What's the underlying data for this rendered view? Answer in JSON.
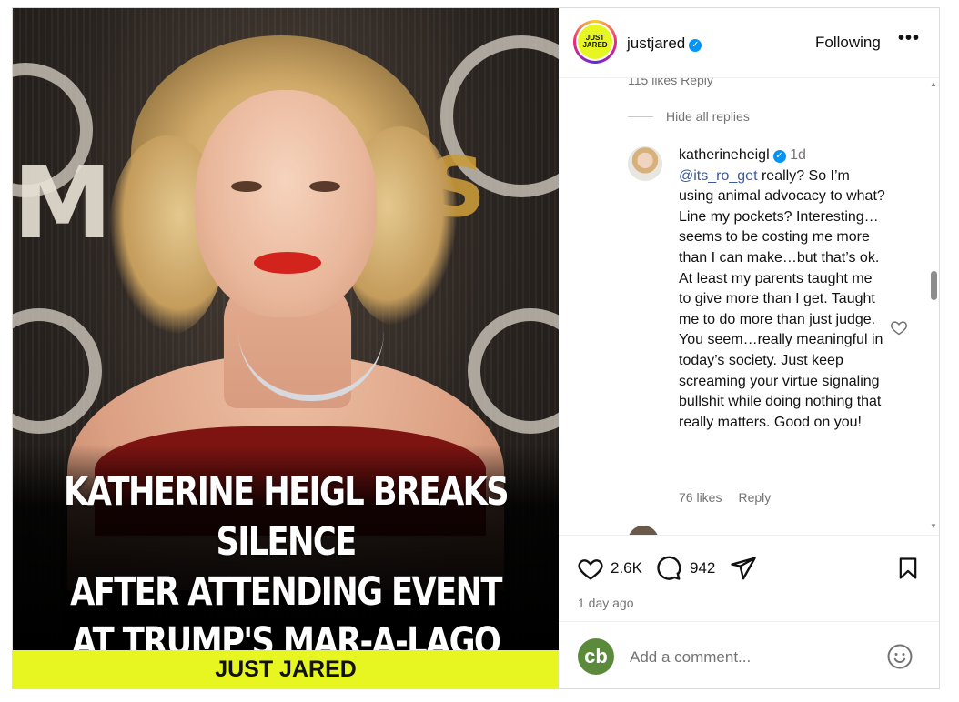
{
  "media": {
    "headline": [
      "KATHERINE HEIGL BREAKS SILENCE",
      "AFTER ATTENDING EVENT",
      "AT TRUMP'S MAR-A-LAGO"
    ],
    "brand": "JUST JARED",
    "brand_color": "#e7f520"
  },
  "header": {
    "avatar_text": "JUST JARED",
    "username": "justjared",
    "verified_icon": "verified-badge-icon",
    "follow_label": "Following",
    "more_label": "•••"
  },
  "comments": {
    "cut_likes": "115 likes   Reply",
    "hide_replies": "Hide all replies",
    "reply": {
      "username": "katherineheigl",
      "time": "1d",
      "mention": "@its_ro_get",
      "text": " really? So I’m using animal advocacy to what? Line my pockets? Interesting…seems to be costing me more than I can make…but that’s ok. At least my parents taught me to give more than I get. Taught me to do more than just judge. You seem…really meaningful in today’s society. Just keep screaming your virtue signaling bullshit while doing nothing that really matters. Good on you!",
      "likes": "76 likes",
      "reply_label": "Reply"
    }
  },
  "actions": {
    "likes_count": "2.6K",
    "comments_count": "942",
    "posted": "1 day ago"
  },
  "add_comment": {
    "avatar_letter": "cb",
    "placeholder": "Add a comment..."
  },
  "colors": {
    "link": "#3b5998",
    "muted": "#737373",
    "verified": "#0095f6"
  }
}
